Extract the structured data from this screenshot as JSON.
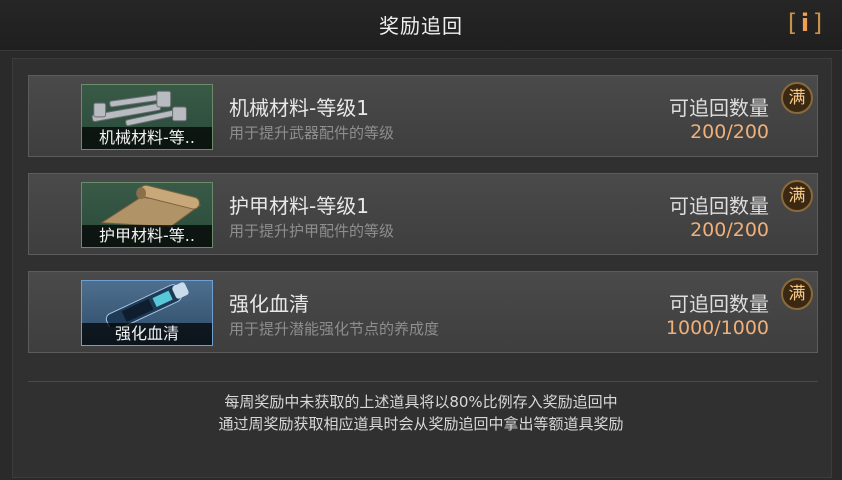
{
  "header": {
    "title": "奖励追回",
    "info_left": "[",
    "info_letter": "i",
    "info_right": "]"
  },
  "items": [
    {
      "thumb_caption": "机械材料-等..",
      "name": "机械材料-等级1",
      "description": "用于提升武器配件的等级",
      "quantity_label": "可追回数量",
      "quantity_value": "200/200",
      "badge": "满",
      "icon": "bolts-icon"
    },
    {
      "thumb_caption": "护甲材料-等..",
      "name": "护甲材料-等级1",
      "description": "用于提升护甲配件的等级",
      "quantity_label": "可追回数量",
      "quantity_value": "200/200",
      "badge": "满",
      "icon": "scroll-icon"
    },
    {
      "thumb_caption": "强化血清",
      "name": "强化血清",
      "description": "用于提升潜能强化节点的养成度",
      "quantity_label": "可追回数量",
      "quantity_value": "1000/1000",
      "badge": "满",
      "icon": "serum-icon"
    }
  ],
  "footer": {
    "line1": "每周奖励中未获取的上述道具将以80%比例存入奖励追回中",
    "line2": "通过周奖励获取相应道具时会从奖励追回中拿出等额道具奖励"
  },
  "colors": {
    "accent": "#f0b07a",
    "badge_text": "#f6c889",
    "info": "#f0a050"
  }
}
